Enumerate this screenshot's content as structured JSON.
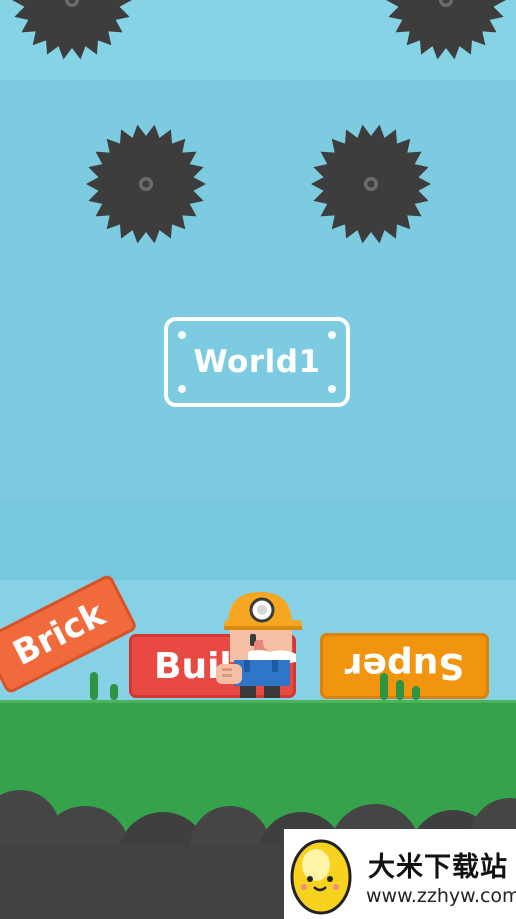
{
  "level": {
    "title": "World1"
  },
  "blocks": {
    "brick": "Brick",
    "build": "Buil",
    "super": "Super"
  },
  "watermark": {
    "name": "大米下载站",
    "url": "www.zzhyw.com"
  },
  "colors": {
    "sky": "#7ccde2",
    "saw": "#3d3d3d",
    "brick_block": "#f06a3c",
    "build_block": "#e84a43",
    "super_block": "#f2950e",
    "ground": "#36a24b"
  }
}
